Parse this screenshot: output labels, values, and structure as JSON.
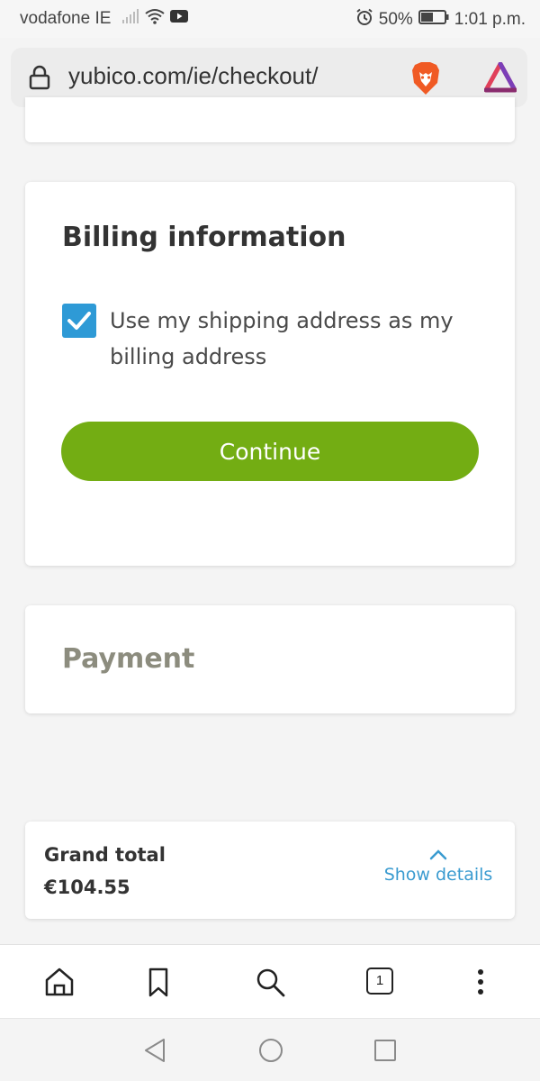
{
  "status_bar": {
    "carrier": "vodafone IE",
    "battery": "50%",
    "time": "1:01 p.m."
  },
  "browser": {
    "url": "yubico.com/ie/checkout/",
    "tab_count": "1",
    "icons": [
      "lock-icon",
      "brave-lion-icon",
      "brave-rewards-icon",
      "home-icon",
      "bookmark-icon",
      "search-icon",
      "tabs-icon",
      "more-icon"
    ]
  },
  "billing": {
    "title": "Billing information",
    "same_address_label": "Use my shipping address as my billing address",
    "same_address_checked": true,
    "continue_label": "Continue"
  },
  "payment": {
    "title": "Payment"
  },
  "summary": {
    "grand_total_label": "Grand total",
    "grand_total_value": "€104.55",
    "show_details_label": "Show details"
  },
  "colors": {
    "accent_green": "#73ad13",
    "checkbox_blue": "#2e9ad6",
    "link_blue": "#3a9bd0",
    "muted_heading": "#8c8c7e"
  }
}
